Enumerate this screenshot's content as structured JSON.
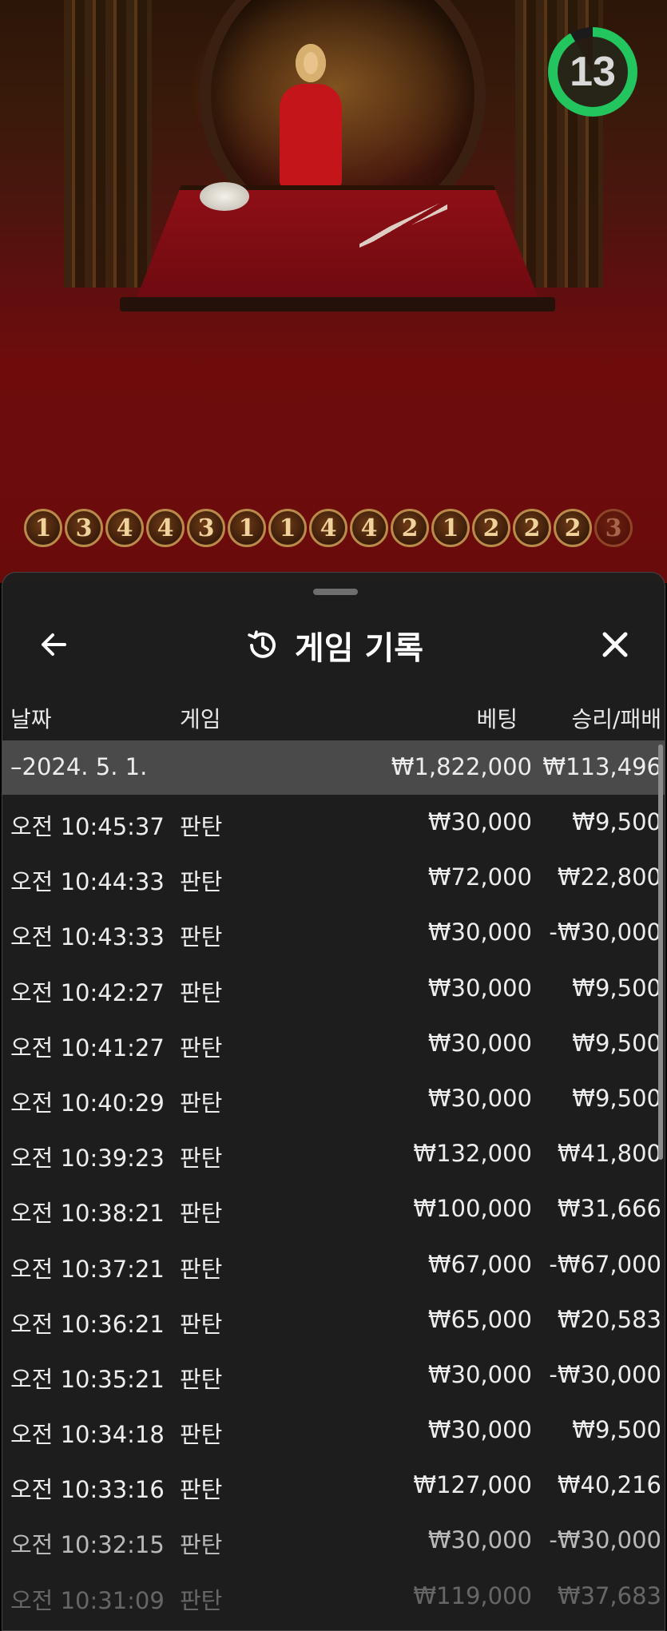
{
  "stream": {
    "timer_value": "13",
    "roadmap": [
      "1",
      "3",
      "4",
      "4",
      "3",
      "1",
      "1",
      "4",
      "4",
      "2",
      "1",
      "2",
      "2",
      "2",
      "3"
    ]
  },
  "panel": {
    "title": "게임 기록",
    "icons": {
      "back": "arrow-left-icon",
      "history": "history-clock-icon",
      "close": "close-icon"
    },
    "columns": {
      "date": "날짜",
      "game": "게임",
      "bet": "베팅",
      "result": "승리/패배"
    },
    "summary": {
      "date": "–2024. 5. 1.",
      "bet": "₩1,822,000",
      "result": "₩113,496"
    },
    "rows": [
      {
        "time": "오전 10:45:37",
        "game": "판탄",
        "bet": "₩30,000",
        "result": "₩9,500"
      },
      {
        "time": "오전 10:44:33",
        "game": "판탄",
        "bet": "₩72,000",
        "result": "₩22,800"
      },
      {
        "time": "오전 10:43:33",
        "game": "판탄",
        "bet": "₩30,000",
        "result": "-₩30,000"
      },
      {
        "time": "오전 10:42:27",
        "game": "판탄",
        "bet": "₩30,000",
        "result": "₩9,500"
      },
      {
        "time": "오전 10:41:27",
        "game": "판탄",
        "bet": "₩30,000",
        "result": "₩9,500"
      },
      {
        "time": "오전 10:40:29",
        "game": "판탄",
        "bet": "₩30,000",
        "result": "₩9,500"
      },
      {
        "time": "오전 10:39:23",
        "game": "판탄",
        "bet": "₩132,000",
        "result": "₩41,800"
      },
      {
        "time": "오전 10:38:21",
        "game": "판탄",
        "bet": "₩100,000",
        "result": "₩31,666"
      },
      {
        "time": "오전 10:37:21",
        "game": "판탄",
        "bet": "₩67,000",
        "result": "-₩67,000"
      },
      {
        "time": "오전 10:36:21",
        "game": "판탄",
        "bet": "₩65,000",
        "result": "₩20,583"
      },
      {
        "time": "오전 10:35:21",
        "game": "판탄",
        "bet": "₩30,000",
        "result": "-₩30,000"
      },
      {
        "time": "오전 10:34:18",
        "game": "판탄",
        "bet": "₩30,000",
        "result": "₩9,500"
      },
      {
        "time": "오전 10:33:16",
        "game": "판탄",
        "bet": "₩127,000",
        "result": "₩40,216"
      },
      {
        "time": "오전 10:32:15",
        "game": "판탄",
        "bet": "₩30,000",
        "result": "-₩30,000"
      },
      {
        "time": "오전 10:31:09",
        "game": "판탄",
        "bet": "₩119,000",
        "result": "₩37,683"
      }
    ]
  }
}
